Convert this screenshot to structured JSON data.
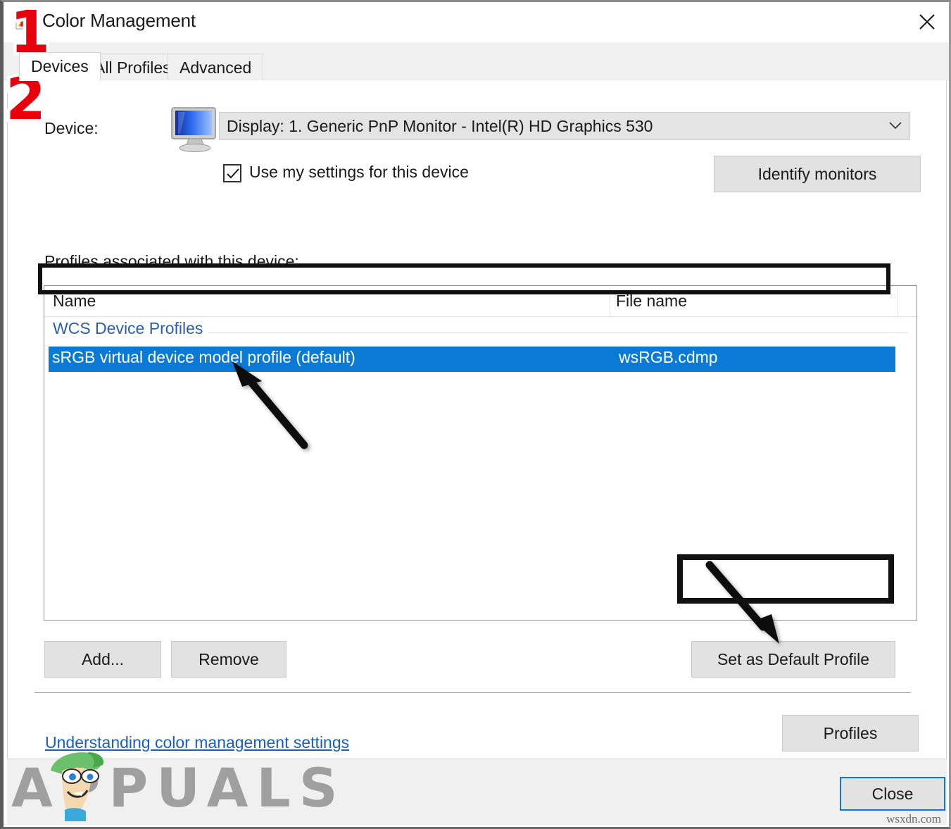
{
  "window": {
    "title": "Color Management",
    "icon": "color-management-icon",
    "close_icon": "close-icon"
  },
  "tabs": [
    {
      "label": "Devices",
      "active": true
    },
    {
      "label": "All Profiles",
      "active": false
    },
    {
      "label": "Advanced",
      "active": false
    }
  ],
  "devices_tab": {
    "device_label": "Device:",
    "device_icon": "monitor-icon",
    "device_combo": {
      "value": "Display: 1. Generic PnP Monitor - Intel(R) HD Graphics 530",
      "arrow_icon": "chevron-down-icon"
    },
    "use_my_settings": {
      "label": "Use my settings for this device",
      "checked": true,
      "check_icon": "checkmark-icon"
    },
    "identify_monitors_label": "Identify monitors",
    "profiles_section_label": "Profiles associated with this device:",
    "list": {
      "columns": [
        "Name",
        "File name"
      ],
      "group_label": "WCS Device Profiles",
      "rows": [
        {
          "name": "sRGB virtual device model profile (default)",
          "file_name": "wsRGB.cdmp",
          "selected": true
        }
      ]
    },
    "add_label": "Add...",
    "remove_label": "Remove",
    "set_default_label": "Set as Default Profile",
    "help_link_label": "Understanding color management settings",
    "profiles_button_label": "Profiles"
  },
  "dialog_footer": {
    "close_label": "Close"
  },
  "annotations": [
    {
      "id": "step-1",
      "label": "1"
    },
    {
      "id": "step-2",
      "label": "2"
    }
  ],
  "watermark": {
    "text": "APPUALS",
    "credit": "wsxdn.com"
  },
  "colors": {
    "selection_blue": "#0a7ad6",
    "link_blue": "#1b5fbe",
    "group_blue": "#2b5faa",
    "annotation_red": "#e8000d",
    "button_face": "#e2e2e2",
    "tabstrip": "#f0f0f0"
  }
}
